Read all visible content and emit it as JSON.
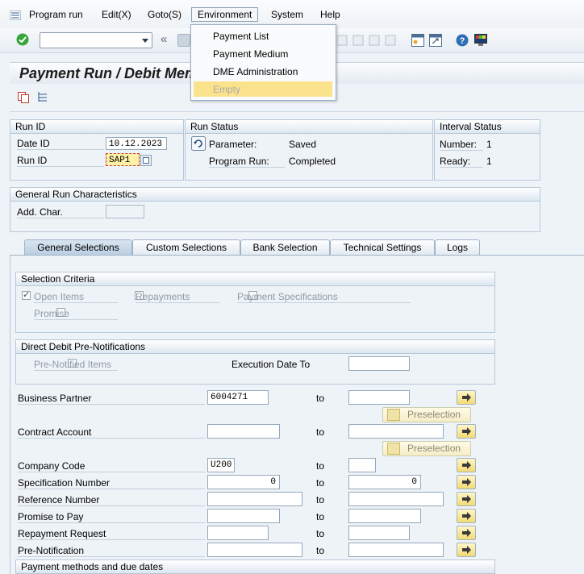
{
  "menubar": {
    "items": [
      "Program run",
      "Edit(X)",
      "Goto(S)",
      "Environment",
      "System",
      "Help"
    ],
    "active": "Environment"
  },
  "toolbar": {
    "command_value": "",
    "nav_glyph": "«"
  },
  "title": "Payment Run / Debit Mem",
  "dropdown": {
    "items": [
      "Payment List",
      "Payment Medium",
      "DME Administration",
      "Empty"
    ]
  },
  "run_id": {
    "header": "Run ID",
    "date_label": "Date ID",
    "date_value": "10.12.2023",
    "id_label": "Run ID",
    "id_value": "SAP1"
  },
  "run_status": {
    "header": "Run Status",
    "parameter_label": "Parameter:",
    "parameter_value": "Saved",
    "program_label": "Program Run:",
    "program_value": "Completed"
  },
  "interval_status": {
    "header": "Interval Status",
    "number_label": "Number:",
    "number_value": "1",
    "ready_label": "Ready:",
    "ready_value": "1"
  },
  "general_chars": {
    "header": "General Run Characteristics",
    "add_char_label": "Add. Char.",
    "add_char_value": ""
  },
  "tabs": [
    "General Selections",
    "Custom Selections",
    "Bank Selection",
    "Technical Settings",
    "Logs"
  ],
  "active_tab": "General Selections",
  "selection_criteria": {
    "header": "Selection Criteria",
    "open_items": "Open Items",
    "open_items_checked": true,
    "repayments": "Repayments",
    "payment_specs": "Payment Specifications",
    "promise": "Promise"
  },
  "direct_debit": {
    "header": "Direct Debit Pre-Notifications",
    "pre_notified": "Pre-Notified Items",
    "exec_date_label": "Execution Date To"
  },
  "to_label": "to",
  "preselection_label": "Preselection",
  "fields": {
    "business_partner": {
      "label": "Business Partner",
      "from": "6004271",
      "to": ""
    },
    "contract_account": {
      "label": "Contract Account",
      "from": "",
      "to": ""
    },
    "company_code": {
      "label": "Company Code",
      "from": "U200",
      "to": ""
    },
    "spec_number": {
      "label": "Specification Number",
      "from": "0",
      "to": "0"
    },
    "reference_number": {
      "label": "Reference Number",
      "from": "",
      "to": ""
    },
    "promise_to_pay": {
      "label": "Promise to Pay",
      "from": "",
      "to": ""
    },
    "repayment_request": {
      "label": "Repayment Request",
      "from": "",
      "to": ""
    },
    "pre_notification": {
      "label": "Pre-Notification",
      "from": "",
      "to": ""
    }
  },
  "payment_methods_header": "Payment methods and due dates",
  "colors": {
    "accent": "#fbe28c",
    "background": "#eef3f8",
    "border": "#b7c8d8"
  }
}
